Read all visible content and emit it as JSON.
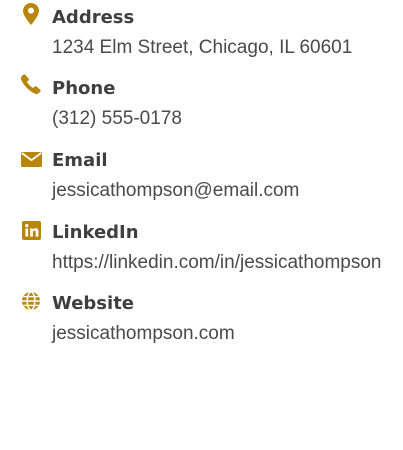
{
  "accent_color": "#b8860b",
  "contacts": [
    {
      "icon": "map-pin-icon",
      "label": "Address",
      "value": "1234 Elm Street, Chicago, IL 60601"
    },
    {
      "icon": "phone-icon",
      "label": "Phone",
      "value": "(312) 555-0178"
    },
    {
      "icon": "envelope-icon",
      "label": "Email",
      "value": "jessicathompson@email.com"
    },
    {
      "icon": "linkedin-icon",
      "label": "LinkedIn",
      "value": "https://linkedin.com/in/jessicathompson"
    },
    {
      "icon": "globe-icon",
      "label": "Website",
      "value": "jessicathompson.com"
    }
  ]
}
